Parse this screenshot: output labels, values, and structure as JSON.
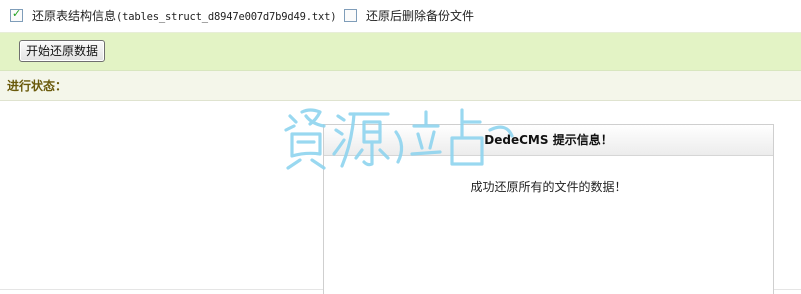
{
  "options": {
    "restore_struct": {
      "checked": true,
      "label": "还原表结构信息",
      "file_paren": "(tables_struct_d8947e007d7b9d49.txt)"
    },
    "delete_backup": {
      "checked": false,
      "label": "还原后删除备份文件"
    }
  },
  "actions": {
    "start_button_label": "开始还原数据"
  },
  "status": {
    "label": "进行状态："
  },
  "message_box": {
    "title": "DedeCMS 提示信息！",
    "body": "成功还原所有的文件的数据！"
  },
  "watermark": {
    "text": "资源站"
  },
  "colors": {
    "action_bar_bg": "#e3f3c5",
    "status_bar_bg": "#f4f6ea",
    "status_label": "#6a5a0b",
    "watermark": "#8fd4ef"
  }
}
